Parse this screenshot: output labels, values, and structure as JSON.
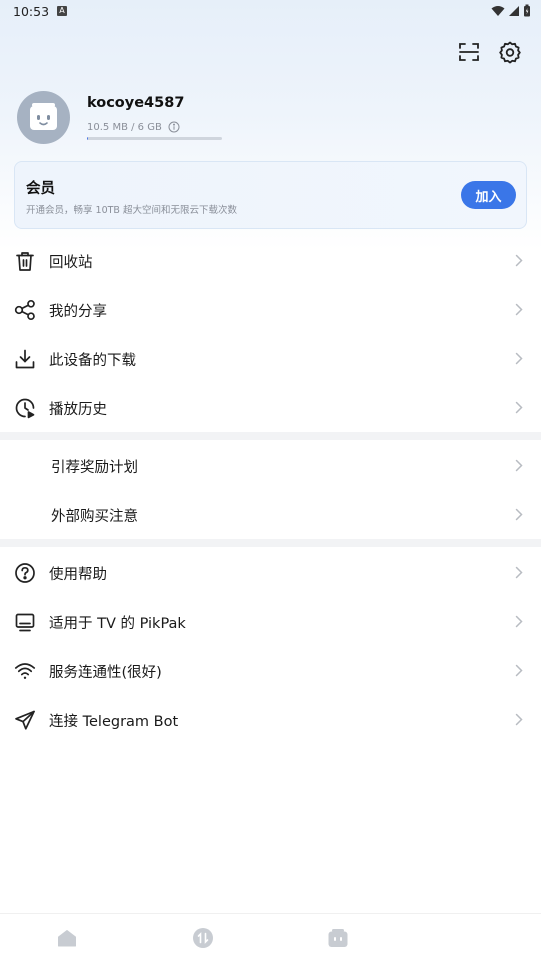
{
  "status_bar": {
    "time": "10:53",
    "notification_badge": "A"
  },
  "header": {
    "scan_icon": "scan-icon",
    "settings_icon": "gear-icon"
  },
  "profile": {
    "username": "kocoye4587",
    "storage_text": "10.5 MB / 6 GB",
    "storage_used_fraction": 0.0017
  },
  "vip": {
    "title": "会员",
    "description": "开通会员，畅享 10TB 超大空间和无限云下载次数",
    "join_label": "加入"
  },
  "menu_group_1": [
    {
      "label": "回收站",
      "icon": "trash-icon"
    },
    {
      "label": "我的分享",
      "icon": "share-icon"
    },
    {
      "label": "此设备的下载",
      "icon": "download-icon"
    },
    {
      "label": "播放历史",
      "icon": "history-icon"
    }
  ],
  "menu_group_2": [
    {
      "label": "引荐奖励计划"
    },
    {
      "label": "外部购买注意"
    }
  ],
  "menu_group_3": [
    {
      "label": "使用帮助",
      "icon": "help-icon"
    },
    {
      "label": "适用于 TV 的 PikPak",
      "icon": "tv-icon"
    },
    {
      "label": "服务连通性(很好)",
      "icon": "wifi-icon"
    },
    {
      "label": "连接 Telegram Bot",
      "icon": "telegram-icon"
    }
  ],
  "bottom_nav": [
    {
      "icon": "home-icon"
    },
    {
      "icon": "transfer-icon"
    },
    {
      "icon": "profile-tab-icon"
    }
  ],
  "colors": {
    "accent": "#3a76e8",
    "text": "#1a1a1a",
    "muted": "#8a8f99"
  }
}
